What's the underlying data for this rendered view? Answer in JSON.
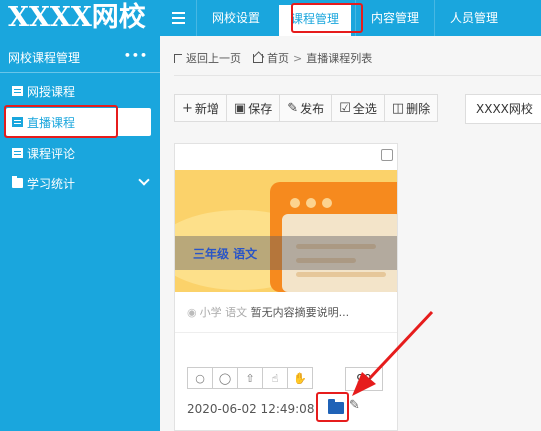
{
  "app": {
    "logo_text": "XXXX网校"
  },
  "topnav": {
    "tabs": [
      {
        "label": "网校设置"
      },
      {
        "label": "课程管理"
      },
      {
        "label": "内容管理"
      },
      {
        "label": "人员管理"
      }
    ]
  },
  "sidebar": {
    "header": "网校课程管理",
    "more": "•••",
    "items": [
      {
        "label": "网授课程"
      },
      {
        "label": "直播课程"
      },
      {
        "label": "课程评论"
      },
      {
        "label": "学习统计"
      }
    ]
  },
  "breadcrumb": {
    "back": "返回上一页",
    "home": "首页",
    "sep": ">",
    "current": "直播课程列表"
  },
  "toolbar": {
    "add": "新增",
    "save": "保存",
    "publish": "发布",
    "select_all": "全选",
    "delete": "删除",
    "school_select": "XXXX网校"
  },
  "card": {
    "thumb_text": "三年级 语文",
    "category": "小学 语文",
    "summary": "暂无内容摘要说明...",
    "count": "99",
    "datetime": "2020-06-02 12:49:08"
  },
  "colors": {
    "primary": "#1aa6dd",
    "highlight": "#e61c1c",
    "folder": "#1f62b7"
  },
  "icons": [
    "menu-icon",
    "back-icon",
    "home-icon",
    "plus-icon",
    "save-icon",
    "publish-icon",
    "check-icon",
    "trash-icon",
    "comment-icon",
    "reply-icon",
    "top-icon",
    "like-icon",
    "hand-icon",
    "folder-icon",
    "pencil-icon",
    "pin-icon"
  ]
}
